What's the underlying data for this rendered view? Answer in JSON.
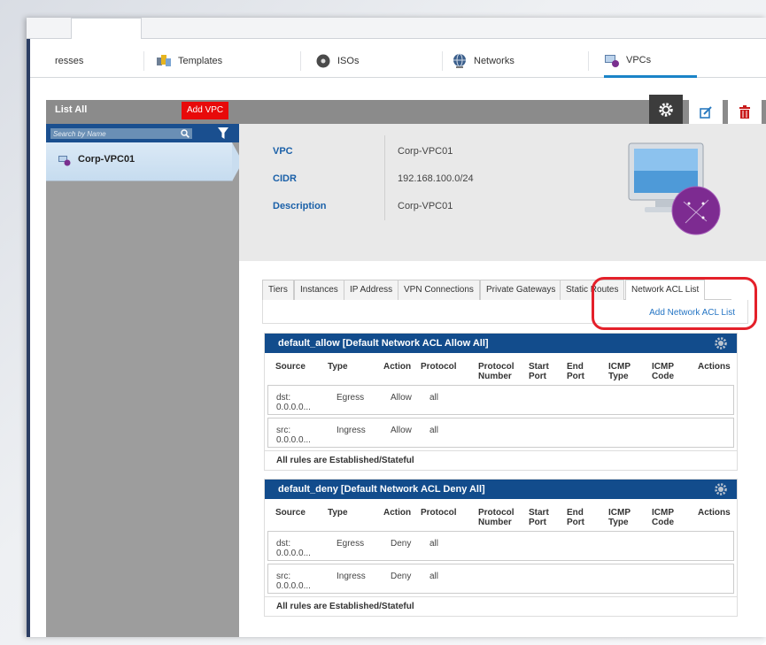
{
  "top_tabs": [
    {
      "label": "resses",
      "icon": "address-icon"
    },
    {
      "label": "Templates",
      "icon": "templates-icon"
    },
    {
      "label": "ISOs",
      "icon": "iso-disc-icon"
    },
    {
      "label": "Networks",
      "icon": "network-globe-icon"
    },
    {
      "label": "VPCs",
      "icon": "vpc-icon"
    }
  ],
  "header": {
    "list_all": "List All",
    "add_vpc": "Add VPC"
  },
  "search": {
    "placeholder": "Search by Name"
  },
  "vpc_list": [
    {
      "name": "Corp-VPC01"
    }
  ],
  "details": {
    "vpc_label": "VPC",
    "vpc_value": "Corp-VPC01",
    "cidr_label": "CIDR",
    "cidr_value": "192.168.100.0/24",
    "description_label": "Description",
    "description_value": "Corp-VPC01"
  },
  "sub_tabs": [
    "Tiers",
    "Instances",
    "IP Address",
    "VPN Connections",
    "Private Gateways",
    "Static Routes",
    "Network ACL List"
  ],
  "add_acl_label": "Add Network ACL List",
  "columns": [
    "Source",
    "Type",
    "Action",
    "Protocol",
    "Protocol Number",
    "Start Port",
    "End Port",
    "ICMP Type",
    "ICMP Code",
    "Actions"
  ],
  "acl_lists": [
    {
      "title": "default_allow [Default Network ACL Allow All]",
      "rows": [
        {
          "source": "dst: 0.0.0.0...",
          "type": "Egress",
          "action": "Allow",
          "protocol": "all"
        },
        {
          "source": "src: 0.0.0.0...",
          "type": "Ingress",
          "action": "Allow",
          "protocol": "all"
        }
      ],
      "footer": "All rules are Established/Stateful"
    },
    {
      "title": "default_deny [Default Network ACL Deny All]",
      "rows": [
        {
          "source": "dst: 0.0.0.0...",
          "type": "Egress",
          "action": "Deny",
          "protocol": "all"
        },
        {
          "source": "src: 0.0.0.0...",
          "type": "Ingress",
          "action": "Deny",
          "protocol": "all"
        }
      ],
      "footer": "All rules are Established/Stateful"
    }
  ],
  "colors": {
    "header_blue": "#124c8c",
    "add_button_red": "#e80a0a",
    "link_blue": "#2575c4",
    "highlight_red": "#e4202a"
  }
}
